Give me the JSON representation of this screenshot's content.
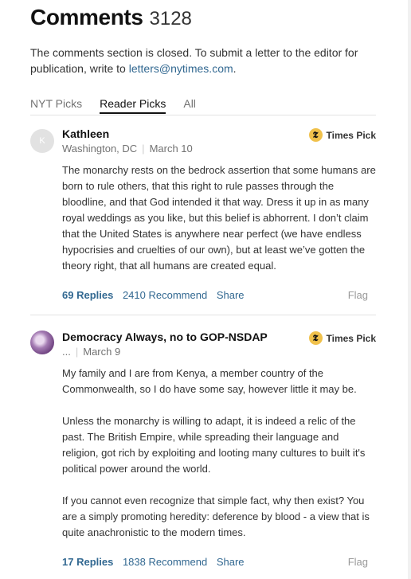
{
  "header": {
    "title": "Comments",
    "count": "3128"
  },
  "notice": {
    "text": "The comments section is closed. To submit a letter to the editor for publication, write to ",
    "email": "letters@nytimes.com",
    "end": "."
  },
  "tabs": [
    "NYT Picks",
    "Reader Picks",
    "All"
  ],
  "comments": [
    {
      "avatar_initial": "K",
      "name": "Kathleen",
      "location": "Washington, DC",
      "date": "March 10",
      "badge": "Times Pick",
      "paragraphs": [
        "The monarchy rests on the bedrock assertion that some humans are born to rule others, that this right to rule passes through the bloodline, and that God intended it that way. Dress it up in as many royal weddings as you like, but this belief is abhorrent. I don’t claim that the United States is anywhere near perfect (we have endless hypocrisies and cruelties of our own), but at least we’ve gotten the theory right, that all humans are created equal."
      ],
      "replies": "69 Replies",
      "recommend": "2410 Recommend",
      "share": "Share",
      "flag": "Flag"
    },
    {
      "name": "Democracy Always, no to GOP-NSDAP",
      "location": "...",
      "date": "March 9",
      "badge": "Times Pick",
      "paragraphs": [
        "My family and I are from Kenya, a member country of the Commonwealth, so I do have some say, however little it may be.",
        "Unless the monarchy is willing to adapt, it is indeed a relic of the past. The British Empire, while spreading their language and religion, got rich by exploiting and looting many cultures to built it's political power around the world.",
        "If you cannot even recognize that simple fact, why then exist? You are a simply promoting heredity: deference by blood - a view that is quite anachronistic to the modern times."
      ],
      "replies": "17 Replies",
      "recommend": "1838 Recommend",
      "share": "Share",
      "flag": "Flag"
    }
  ]
}
